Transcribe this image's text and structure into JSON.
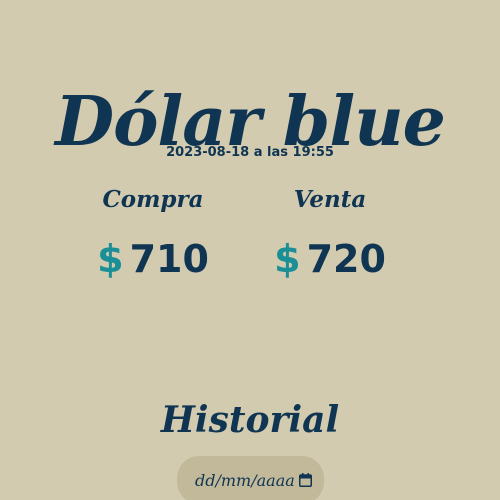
{
  "header": {
    "title": "Dólar blue",
    "timestamp": "2023-08-18 a las 19:55"
  },
  "rates": {
    "buy": {
      "label": "Compra",
      "currency": "$",
      "amount": "710"
    },
    "sell": {
      "label": "Venta",
      "currency": "$",
      "amount": "720"
    }
  },
  "history": {
    "title": "Historial",
    "date_input": {
      "placeholder": "dd/mm/aaaa",
      "icon": "calendar-icon"
    }
  },
  "colors": {
    "background": "#d3cbb0",
    "text": "#0f3552",
    "accent": "#1a8f96",
    "input_bg": "#c2b99a"
  }
}
